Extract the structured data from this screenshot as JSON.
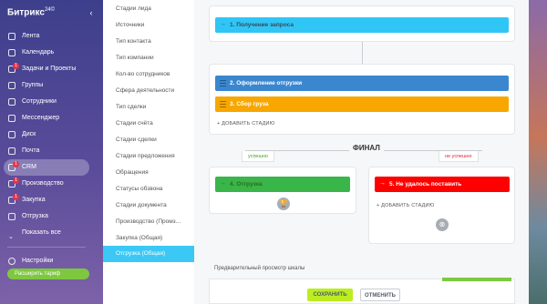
{
  "app": {
    "brand": "Битрикс",
    "brand_version": "24",
    "brand_suffix": "©"
  },
  "leftnav": {
    "items": [
      {
        "label": "Лента",
        "icon": "feed-icon"
      },
      {
        "label": "Календарь",
        "icon": "calendar-icon"
      },
      {
        "label": "Задачи и Проекты",
        "icon": "tasks-icon",
        "badge": "1"
      },
      {
        "label": "Группы",
        "icon": "groups-icon"
      },
      {
        "label": "Сотрудники",
        "icon": "employees-icon"
      },
      {
        "label": "Мессенджер",
        "icon": "messenger-icon"
      },
      {
        "label": "Диск",
        "icon": "disk-icon"
      },
      {
        "label": "Почта",
        "icon": "mail-icon"
      },
      {
        "label": "CRM",
        "icon": "crm-icon",
        "badge": "1",
        "active": true
      },
      {
        "label": "Производство",
        "icon": "production-icon",
        "badge": "1"
      },
      {
        "label": "Закупка",
        "icon": "purchase-icon",
        "badge": "1"
      },
      {
        "label": "Отгрузка",
        "icon": "shipment-icon"
      },
      {
        "label": "Показать все",
        "icon": "chevron-down-icon"
      }
    ],
    "settings_label": "Настройки",
    "upgrade_label": "Расширить тариф"
  },
  "settings_menu": {
    "items": [
      "Стадии лида",
      "Источники",
      "Тип контакта",
      "Тип компании",
      "Кол-во сотрудников",
      "Сфера деятельности",
      "Тип сделки",
      "Стадии счёта",
      "Стадии сделки",
      "Стадии предложения",
      "Обращения",
      "Статусы обзвона",
      "Стадии документа",
      "Производство (Промз...",
      "Закупка (Общая)",
      "Отгрузка (Общая)"
    ],
    "active_index": 15
  },
  "pipeline": {
    "stages_top": [
      {
        "label": "1. Получение запроса",
        "color": "#2fc6f6"
      }
    ],
    "stages_mid": [
      {
        "label": "2. Оформление отгрузки",
        "color": "#3a87d0"
      },
      {
        "label": "3. Сбор груза",
        "color": "#f7a700"
      }
    ],
    "add_stage_label": "+ ДОБАВИТЬ СТАДИЮ",
    "final_title": "ФИНАЛ",
    "success_tag": "успешно",
    "failure_tag": "не успешно",
    "success_stage": {
      "label": "4. Отгрузка",
      "color": "#39b54a"
    },
    "failure_stage": {
      "label": "5. Не удалось поставить",
      "color": "#ff0000"
    }
  },
  "preview": {
    "title": "Предварительный просмотр шкалы"
  },
  "footer": {
    "save_label": "СОХРАНИТЬ",
    "cancel_label": "ОТМЕНИТЬ"
  }
}
